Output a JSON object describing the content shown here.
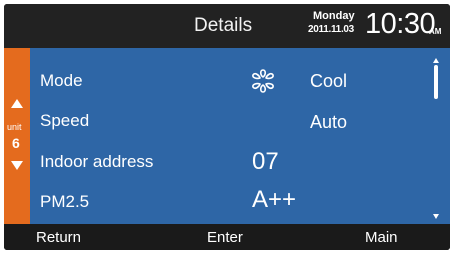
{
  "header": {
    "title": "Details",
    "weekday": "Monday",
    "date": "2011.11.03",
    "time": "10:30",
    "ampm": "AM"
  },
  "unit": {
    "label": "unit",
    "number": "6"
  },
  "rows": [
    {
      "label": "Mode",
      "value": "Cool",
      "icon": "snowflake-icon"
    },
    {
      "label": "Speed",
      "value": "Auto"
    },
    {
      "label": "Indoor address",
      "value": "07"
    },
    {
      "label": "PM2.5",
      "value": "A++"
    }
  ],
  "footer": {
    "return_label": "Return",
    "enter_label": "Enter",
    "main_label": "Main"
  },
  "colors": {
    "content_bg": "#2e66a6",
    "unit_bar": "#e46b1e",
    "header_bg": "#222222"
  }
}
